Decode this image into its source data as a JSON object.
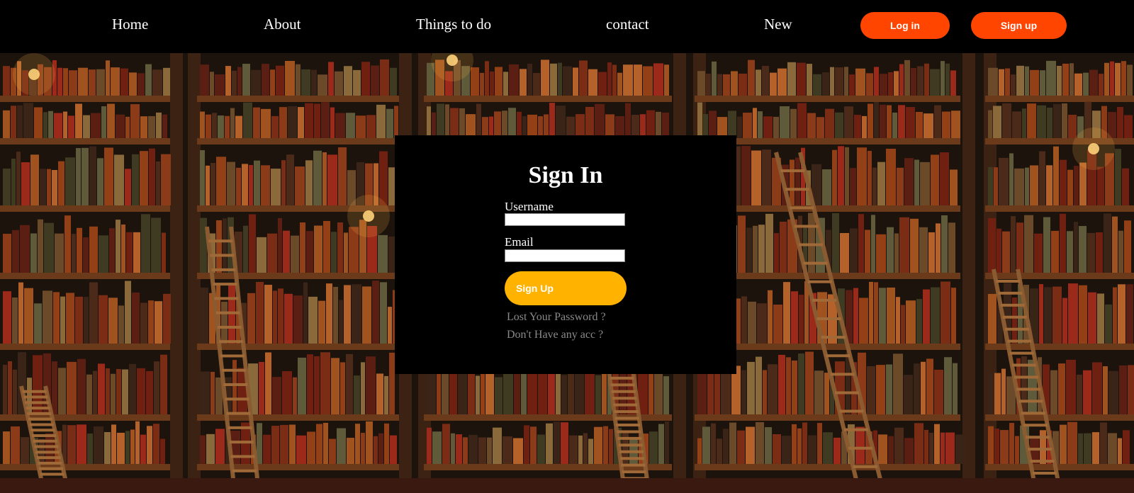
{
  "nav": {
    "links": [
      "Home",
      "About",
      "Things to do",
      "contact",
      "New"
    ],
    "login_label": "Log in",
    "signup_label": "Sign up"
  },
  "form": {
    "title": "Sign In",
    "username_label": "Username",
    "email_label": "Email",
    "submit_label": "Sign Up",
    "lost_password": "Lost Your Password ?",
    "no_account": "Don't Have any acc ?"
  },
  "colors": {
    "nav_bg": "#000000",
    "accent_orange": "#ff4500",
    "submit_yellow": "#ffb300",
    "modal_bg": "#000000"
  }
}
